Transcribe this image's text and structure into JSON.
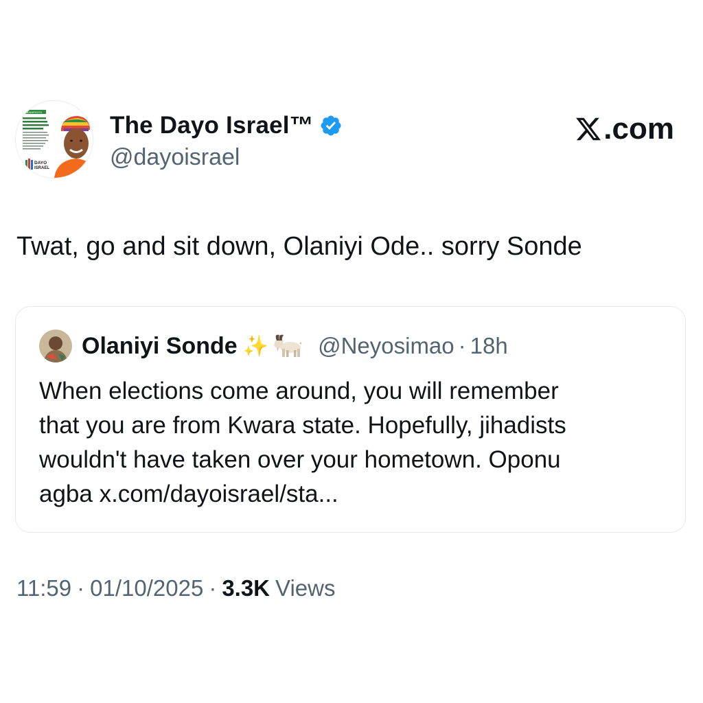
{
  "author": {
    "display_name": "The Dayo Israel™",
    "handle": "@dayoisrael",
    "verified": true,
    "verified_color": "#1d9bf0",
    "avatar_text": {
      "tag": "MANIFESTO",
      "lines": [
        "I am on a mission to",
        "revive and renew youth",
        "participation in politics,",
        "making politics"
      ],
      "brand": "DAYO ISRAEL"
    }
  },
  "brand": {
    "label": ".com",
    "icon": "x-logo-icon"
  },
  "tweet": {
    "text": "Twat, go and sit down, Olaniyi Ode.. sorry Sonde"
  },
  "quoted_tweet": {
    "display_name": "Olaniyi Sonde",
    "emoji_sparkles": "✨",
    "emoji_goat": "goat-icon",
    "handle": "@Neyosimao",
    "dot": "·",
    "time": "18h",
    "text": "When elections come around, you will remember\nthat you are from Kwara state. Hopefully, jihadists\nwouldn't have taken over your hometown.  Oponu\nagba x.com/dayoisrael/sta..."
  },
  "meta": {
    "time": "11:59",
    "dot": "·",
    "date": "01/10/2025",
    "views_count": "3.3K",
    "views_label": "Views"
  },
  "colors": {
    "text_primary": "#0f1419",
    "text_secondary": "#536471",
    "border": "#e4e8eb",
    "accent": "#1d9bf0"
  }
}
